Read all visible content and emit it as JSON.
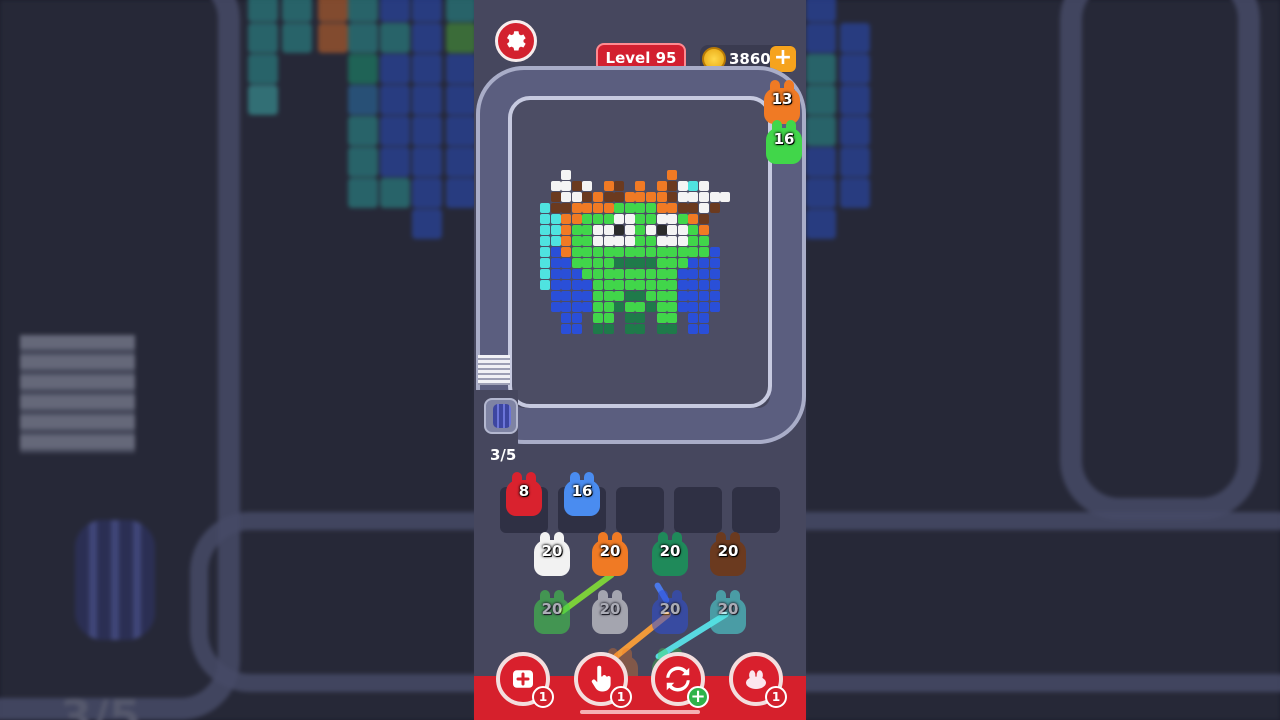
{
  "hud": {
    "level_label": "Level 95",
    "coins": "3860",
    "coin_add_label": "+",
    "slot_counter": "3/5"
  },
  "conveyor_critters": [
    {
      "count": "13",
      "color": "#f07a24"
    },
    {
      "count": "16",
      "color": "#41d64a"
    }
  ],
  "holding_slots": [
    {
      "count": "8",
      "color": "#d9222e"
    },
    {
      "count": "16",
      "color": "#4a8cf0"
    },
    {
      "count": "",
      "color": ""
    },
    {
      "count": "",
      "color": ""
    },
    {
      "count": "",
      "color": ""
    }
  ],
  "queue_front": [
    {
      "count": "20",
      "color": "#f2f2f2"
    },
    {
      "count": "20",
      "color": "#f07a24"
    },
    {
      "count": "20",
      "color": "#1f8a5a"
    },
    {
      "count": "20",
      "color": "#6b3a1f"
    }
  ],
  "queue_back": [
    {
      "count": "20",
      "color": "#41d64a"
    },
    {
      "count": "20",
      "color": "#f2f2f2"
    },
    {
      "count": "20",
      "color": "#2e4fd8"
    },
    {
      "count": "20",
      "color": "#4fe3e0"
    }
  ],
  "tools": [
    {
      "name": "add-slot",
      "badge": "1"
    },
    {
      "name": "pick",
      "badge": "1"
    },
    {
      "name": "shuffle",
      "badge": "+"
    },
    {
      "name": "magnet",
      "badge": "1"
    }
  ],
  "colors": {
    "accent_red": "#d6202c",
    "track": "#5b5e7f",
    "board": "#4c4d64"
  }
}
